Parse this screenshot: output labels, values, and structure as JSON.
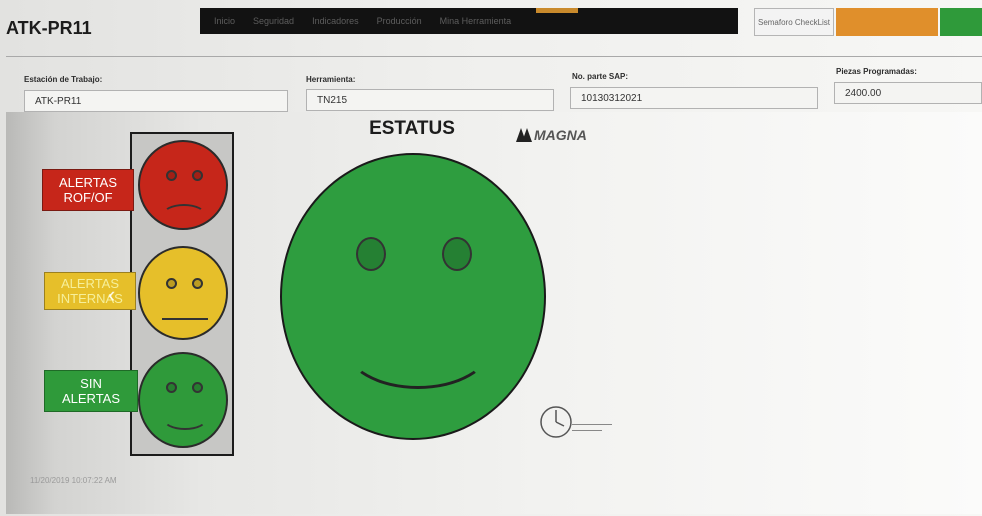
{
  "app": {
    "title": "ATK-PR11"
  },
  "navbar": {
    "items": [
      "Inicio",
      "Seguridad",
      "Indicadores",
      "Producción",
      "Mina Herramienta"
    ]
  },
  "top_right": {
    "checklist_label": "Semaforo CheckList",
    "colors": {
      "orange": "#e08f2b",
      "green": "#2f9a3a"
    }
  },
  "fields": {
    "workstation": {
      "label": "Estación de Trabajo:",
      "value": "ATK-PR11"
    },
    "tool": {
      "label": "Herramienta:",
      "value": "TN215"
    },
    "sap_part": {
      "label": "No. parte SAP:",
      "value": "10130312021"
    },
    "scheduled_pieces": {
      "label": "Piezas Programadas:",
      "value": "2400.00"
    }
  },
  "status": {
    "title": "ESTATUS",
    "current": "green",
    "big_face_color": "#2e9d3f"
  },
  "alerts": [
    {
      "label": "ALERTAS\nROF/OF",
      "color": "#c6261a"
    },
    {
      "label": "ALERTAS\nINTERNAS",
      "color": "#e6bf2a"
    },
    {
      "label": "SIN\nALERTAS",
      "color": "#2f9a3a"
    }
  ],
  "logo": {
    "text": "MAGNA"
  },
  "footer": {
    "timestamp": "11/20/2019 10:07:22 AM"
  }
}
